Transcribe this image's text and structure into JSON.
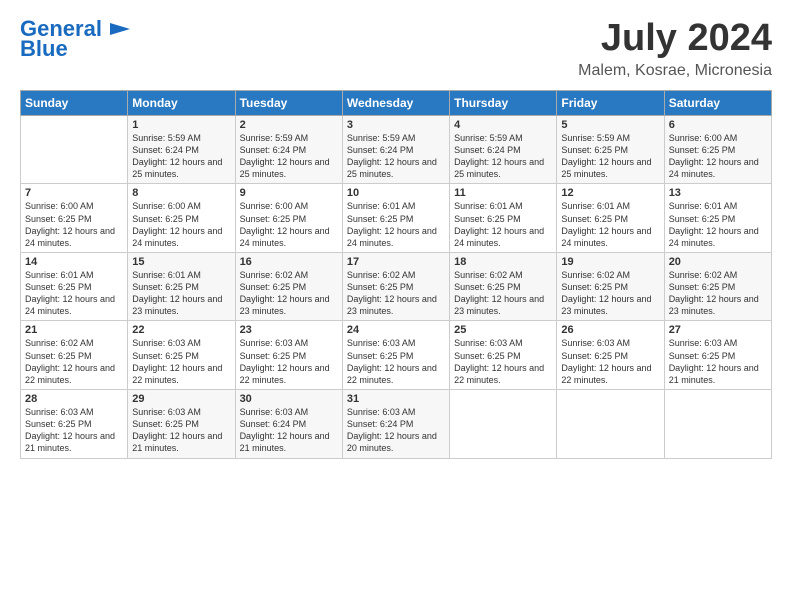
{
  "logo": {
    "line1": "General",
    "line2": "Blue"
  },
  "title": "July 2024",
  "subtitle": "Malem, Kosrae, Micronesia",
  "header": {
    "days": [
      "Sunday",
      "Monday",
      "Tuesday",
      "Wednesday",
      "Thursday",
      "Friday",
      "Saturday"
    ]
  },
  "weeks": [
    {
      "cells": [
        {
          "day": "",
          "sunrise": "",
          "sunset": "",
          "daylight": "",
          "empty": true
        },
        {
          "day": "1",
          "sunrise": "Sunrise: 5:59 AM",
          "sunset": "Sunset: 6:24 PM",
          "daylight": "Daylight: 12 hours and 25 minutes."
        },
        {
          "day": "2",
          "sunrise": "Sunrise: 5:59 AM",
          "sunset": "Sunset: 6:24 PM",
          "daylight": "Daylight: 12 hours and 25 minutes."
        },
        {
          "day": "3",
          "sunrise": "Sunrise: 5:59 AM",
          "sunset": "Sunset: 6:24 PM",
          "daylight": "Daylight: 12 hours and 25 minutes."
        },
        {
          "day": "4",
          "sunrise": "Sunrise: 5:59 AM",
          "sunset": "Sunset: 6:24 PM",
          "daylight": "Daylight: 12 hours and 25 minutes."
        },
        {
          "day": "5",
          "sunrise": "Sunrise: 5:59 AM",
          "sunset": "Sunset: 6:25 PM",
          "daylight": "Daylight: 12 hours and 25 minutes."
        },
        {
          "day": "6",
          "sunrise": "Sunrise: 6:00 AM",
          "sunset": "Sunset: 6:25 PM",
          "daylight": "Daylight: 12 hours and 24 minutes."
        }
      ]
    },
    {
      "cells": [
        {
          "day": "7",
          "sunrise": "Sunrise: 6:00 AM",
          "sunset": "Sunset: 6:25 PM",
          "daylight": "Daylight: 12 hours and 24 minutes."
        },
        {
          "day": "8",
          "sunrise": "Sunrise: 6:00 AM",
          "sunset": "Sunset: 6:25 PM",
          "daylight": "Daylight: 12 hours and 24 minutes."
        },
        {
          "day": "9",
          "sunrise": "Sunrise: 6:00 AM",
          "sunset": "Sunset: 6:25 PM",
          "daylight": "Daylight: 12 hours and 24 minutes."
        },
        {
          "day": "10",
          "sunrise": "Sunrise: 6:01 AM",
          "sunset": "Sunset: 6:25 PM",
          "daylight": "Daylight: 12 hours and 24 minutes."
        },
        {
          "day": "11",
          "sunrise": "Sunrise: 6:01 AM",
          "sunset": "Sunset: 6:25 PM",
          "daylight": "Daylight: 12 hours and 24 minutes."
        },
        {
          "day": "12",
          "sunrise": "Sunrise: 6:01 AM",
          "sunset": "Sunset: 6:25 PM",
          "daylight": "Daylight: 12 hours and 24 minutes."
        },
        {
          "day": "13",
          "sunrise": "Sunrise: 6:01 AM",
          "sunset": "Sunset: 6:25 PM",
          "daylight": "Daylight: 12 hours and 24 minutes."
        }
      ]
    },
    {
      "cells": [
        {
          "day": "14",
          "sunrise": "Sunrise: 6:01 AM",
          "sunset": "Sunset: 6:25 PM",
          "daylight": "Daylight: 12 hours and 24 minutes."
        },
        {
          "day": "15",
          "sunrise": "Sunrise: 6:01 AM",
          "sunset": "Sunset: 6:25 PM",
          "daylight": "Daylight: 12 hours and 23 minutes."
        },
        {
          "day": "16",
          "sunrise": "Sunrise: 6:02 AM",
          "sunset": "Sunset: 6:25 PM",
          "daylight": "Daylight: 12 hours and 23 minutes."
        },
        {
          "day": "17",
          "sunrise": "Sunrise: 6:02 AM",
          "sunset": "Sunset: 6:25 PM",
          "daylight": "Daylight: 12 hours and 23 minutes."
        },
        {
          "day": "18",
          "sunrise": "Sunrise: 6:02 AM",
          "sunset": "Sunset: 6:25 PM",
          "daylight": "Daylight: 12 hours and 23 minutes."
        },
        {
          "day": "19",
          "sunrise": "Sunrise: 6:02 AM",
          "sunset": "Sunset: 6:25 PM",
          "daylight": "Daylight: 12 hours and 23 minutes."
        },
        {
          "day": "20",
          "sunrise": "Sunrise: 6:02 AM",
          "sunset": "Sunset: 6:25 PM",
          "daylight": "Daylight: 12 hours and 23 minutes."
        }
      ]
    },
    {
      "cells": [
        {
          "day": "21",
          "sunrise": "Sunrise: 6:02 AM",
          "sunset": "Sunset: 6:25 PM",
          "daylight": "Daylight: 12 hours and 22 minutes."
        },
        {
          "day": "22",
          "sunrise": "Sunrise: 6:03 AM",
          "sunset": "Sunset: 6:25 PM",
          "daylight": "Daylight: 12 hours and 22 minutes."
        },
        {
          "day": "23",
          "sunrise": "Sunrise: 6:03 AM",
          "sunset": "Sunset: 6:25 PM",
          "daylight": "Daylight: 12 hours and 22 minutes."
        },
        {
          "day": "24",
          "sunrise": "Sunrise: 6:03 AM",
          "sunset": "Sunset: 6:25 PM",
          "daylight": "Daylight: 12 hours and 22 minutes."
        },
        {
          "day": "25",
          "sunrise": "Sunrise: 6:03 AM",
          "sunset": "Sunset: 6:25 PM",
          "daylight": "Daylight: 12 hours and 22 minutes."
        },
        {
          "day": "26",
          "sunrise": "Sunrise: 6:03 AM",
          "sunset": "Sunset: 6:25 PM",
          "daylight": "Daylight: 12 hours and 22 minutes."
        },
        {
          "day": "27",
          "sunrise": "Sunrise: 6:03 AM",
          "sunset": "Sunset: 6:25 PM",
          "daylight": "Daylight: 12 hours and 21 minutes."
        }
      ]
    },
    {
      "cells": [
        {
          "day": "28",
          "sunrise": "Sunrise: 6:03 AM",
          "sunset": "Sunset: 6:25 PM",
          "daylight": "Daylight: 12 hours and 21 minutes."
        },
        {
          "day": "29",
          "sunrise": "Sunrise: 6:03 AM",
          "sunset": "Sunset: 6:25 PM",
          "daylight": "Daylight: 12 hours and 21 minutes."
        },
        {
          "day": "30",
          "sunrise": "Sunrise: 6:03 AM",
          "sunset": "Sunset: 6:24 PM",
          "daylight": "Daylight: 12 hours and 21 minutes."
        },
        {
          "day": "31",
          "sunrise": "Sunrise: 6:03 AM",
          "sunset": "Sunset: 6:24 PM",
          "daylight": "Daylight: 12 hours and 20 minutes."
        },
        {
          "day": "",
          "empty": true
        },
        {
          "day": "",
          "empty": true
        },
        {
          "day": "",
          "empty": true
        }
      ]
    }
  ]
}
